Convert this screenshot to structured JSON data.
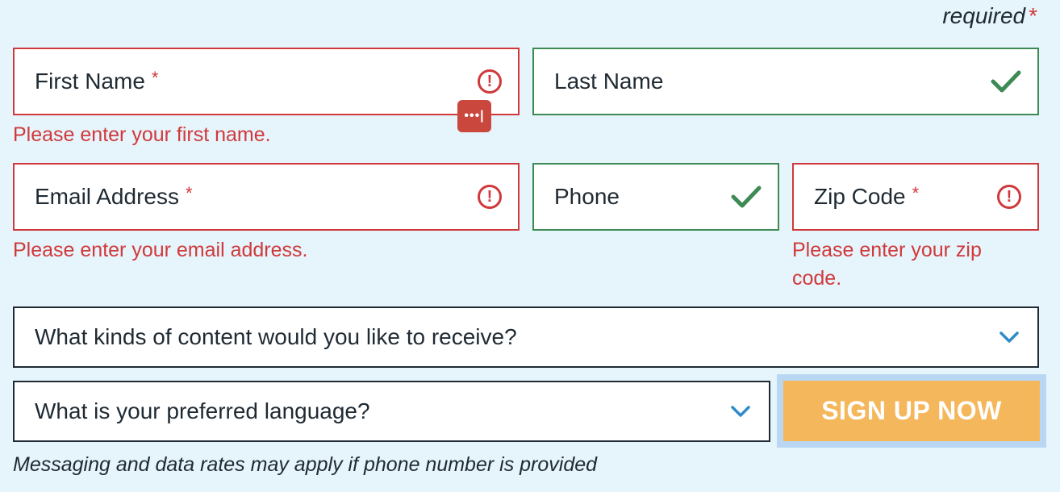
{
  "required_note": {
    "text": "required",
    "star": "*"
  },
  "fields": {
    "first_name": {
      "label": "First Name",
      "star": "*",
      "error": "Please enter your first name."
    },
    "last_name": {
      "label": "Last Name"
    },
    "email": {
      "label": "Email Address",
      "star": "*",
      "error": "Please enter your email address."
    },
    "phone": {
      "label": "Phone"
    },
    "zip": {
      "label": "Zip Code",
      "star": "*",
      "error_line1": "Please enter your zip",
      "error_line2": "code."
    }
  },
  "selects": {
    "content": {
      "label": "What kinds of content would you like to receive?"
    },
    "language": {
      "label": "What is your preferred language?"
    }
  },
  "password_badge": {
    "text": "•••|"
  },
  "signup_button": {
    "label": "SIGN UP NOW"
  },
  "disclaimer": "Messaging and data rates may apply if phone number is provided",
  "colors": {
    "background": "#e6f4fb",
    "error": "#d0393b",
    "valid": "#3d8a54",
    "button": "#f5b75b",
    "chevron": "#2e8bc9"
  },
  "icons": [
    "alert-circle-icon",
    "check-icon",
    "chevron-down-icon",
    "password-manager-icon"
  ]
}
